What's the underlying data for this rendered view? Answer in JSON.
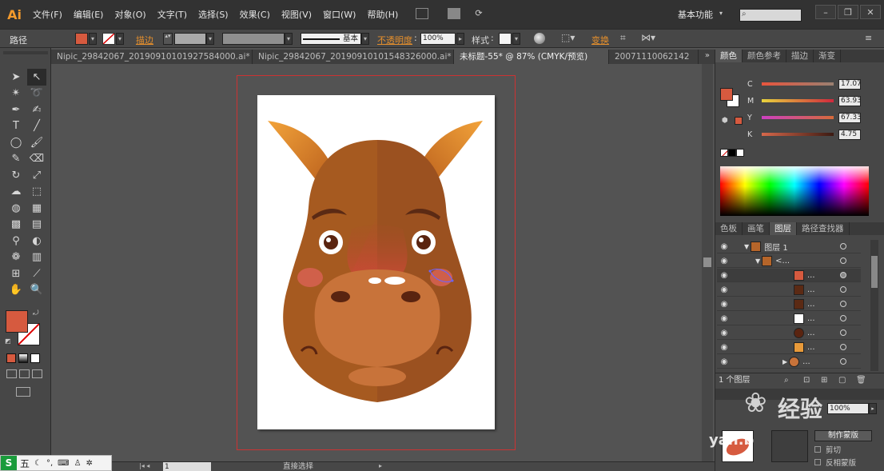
{
  "app": {
    "logo": "Ai"
  },
  "menu": [
    "文件(F)",
    "编辑(E)",
    "对象(O)",
    "文字(T)",
    "选择(S)",
    "效果(C)",
    "视图(V)",
    "窗口(W)",
    "帮助(H)"
  ],
  "workspace": "基本功能",
  "window_buttons": [
    "–",
    "❐",
    "✕"
  ],
  "control": {
    "selection_label": "路径",
    "stroke_link": "描边",
    "brush_label": "基本",
    "opacity_link": "不透明度",
    "opacity_value": "100%",
    "style_label": "样式",
    "transform_link": "变换",
    "fill_color": "#d65a3f"
  },
  "tabs": [
    {
      "label": "Nipic_29842067_20190910101927584000.ai*",
      "active": false
    },
    {
      "label": "Nipic_29842067_20190910101548326000.ai*",
      "active": false
    },
    {
      "label": "未标题-55* @ 87% (CMYK/预览)",
      "active": true
    },
    {
      "label": "20071110062142",
      "active": false
    }
  ],
  "tools": [
    "selection-icon",
    "direct-selection-icon",
    "magic-wand-icon",
    "lasso-icon",
    "pen-icon",
    "curvature-icon",
    "type-icon",
    "line-icon",
    "ellipse-icon",
    "paintbrush-icon",
    "pencil-icon",
    "eraser-icon",
    "rotate-icon",
    "scale-icon",
    "warp-icon",
    "free-transform-icon",
    "shape-builder-icon",
    "perspective-icon",
    "mesh-icon",
    "gradient-icon",
    "eyedropper-icon",
    "blend-icon",
    "symbol-sprayer-icon",
    "graph-icon",
    "artboard-icon",
    "slice-icon",
    "hand-icon",
    "zoom-icon"
  ],
  "color_panel": {
    "tabs": [
      "颜色",
      "颜色参考",
      "描边",
      "渐变"
    ],
    "sliders": [
      {
        "label": "C",
        "value": "17.07",
        "gradient": "linear-gradient(to right, #e8553d, #9a8071)"
      },
      {
        "label": "M",
        "value": "63.93",
        "gradient": "linear-gradient(to right, #e7d33d, #d0283d)"
      },
      {
        "label": "Y",
        "value": "67.33",
        "gradient": "linear-gradient(to right, #cc40c0, #d66a3a)"
      },
      {
        "label": "K",
        "value": "4.75",
        "gradient": "linear-gradient(to right, #d7684b, #3b1a12)"
      }
    ]
  },
  "layers_panel": {
    "tabs": [
      "色板",
      "画笔",
      "图层",
      "路径查找器"
    ],
    "rows": [
      {
        "name": "图层 1",
        "indent": 0
      },
      {
        "name": "<...",
        "indent": 1
      },
      {
        "name": "...",
        "indent": 2
      },
      {
        "name": "...",
        "indent": 2
      },
      {
        "name": "...",
        "indent": 2
      },
      {
        "name": "...",
        "indent": 2
      },
      {
        "name": "...",
        "indent": 2
      },
      {
        "name": "...",
        "indent": 2
      },
      {
        "name": "...",
        "indent": 2
      },
      {
        "name": "...",
        "indent": 2
      }
    ],
    "footer": "1 个图层"
  },
  "transparency_panel": {
    "opacity_value": "100%",
    "make_mask": "制作蒙版",
    "clip": "剪切",
    "invert_mask": "反相蒙版"
  },
  "status": {
    "zoom": "1",
    "tool": "直接选择"
  },
  "ime": {
    "logo": "S",
    "mode": "五"
  },
  "watermark": {
    "brand": "经验",
    "site": "yan.b"
  }
}
